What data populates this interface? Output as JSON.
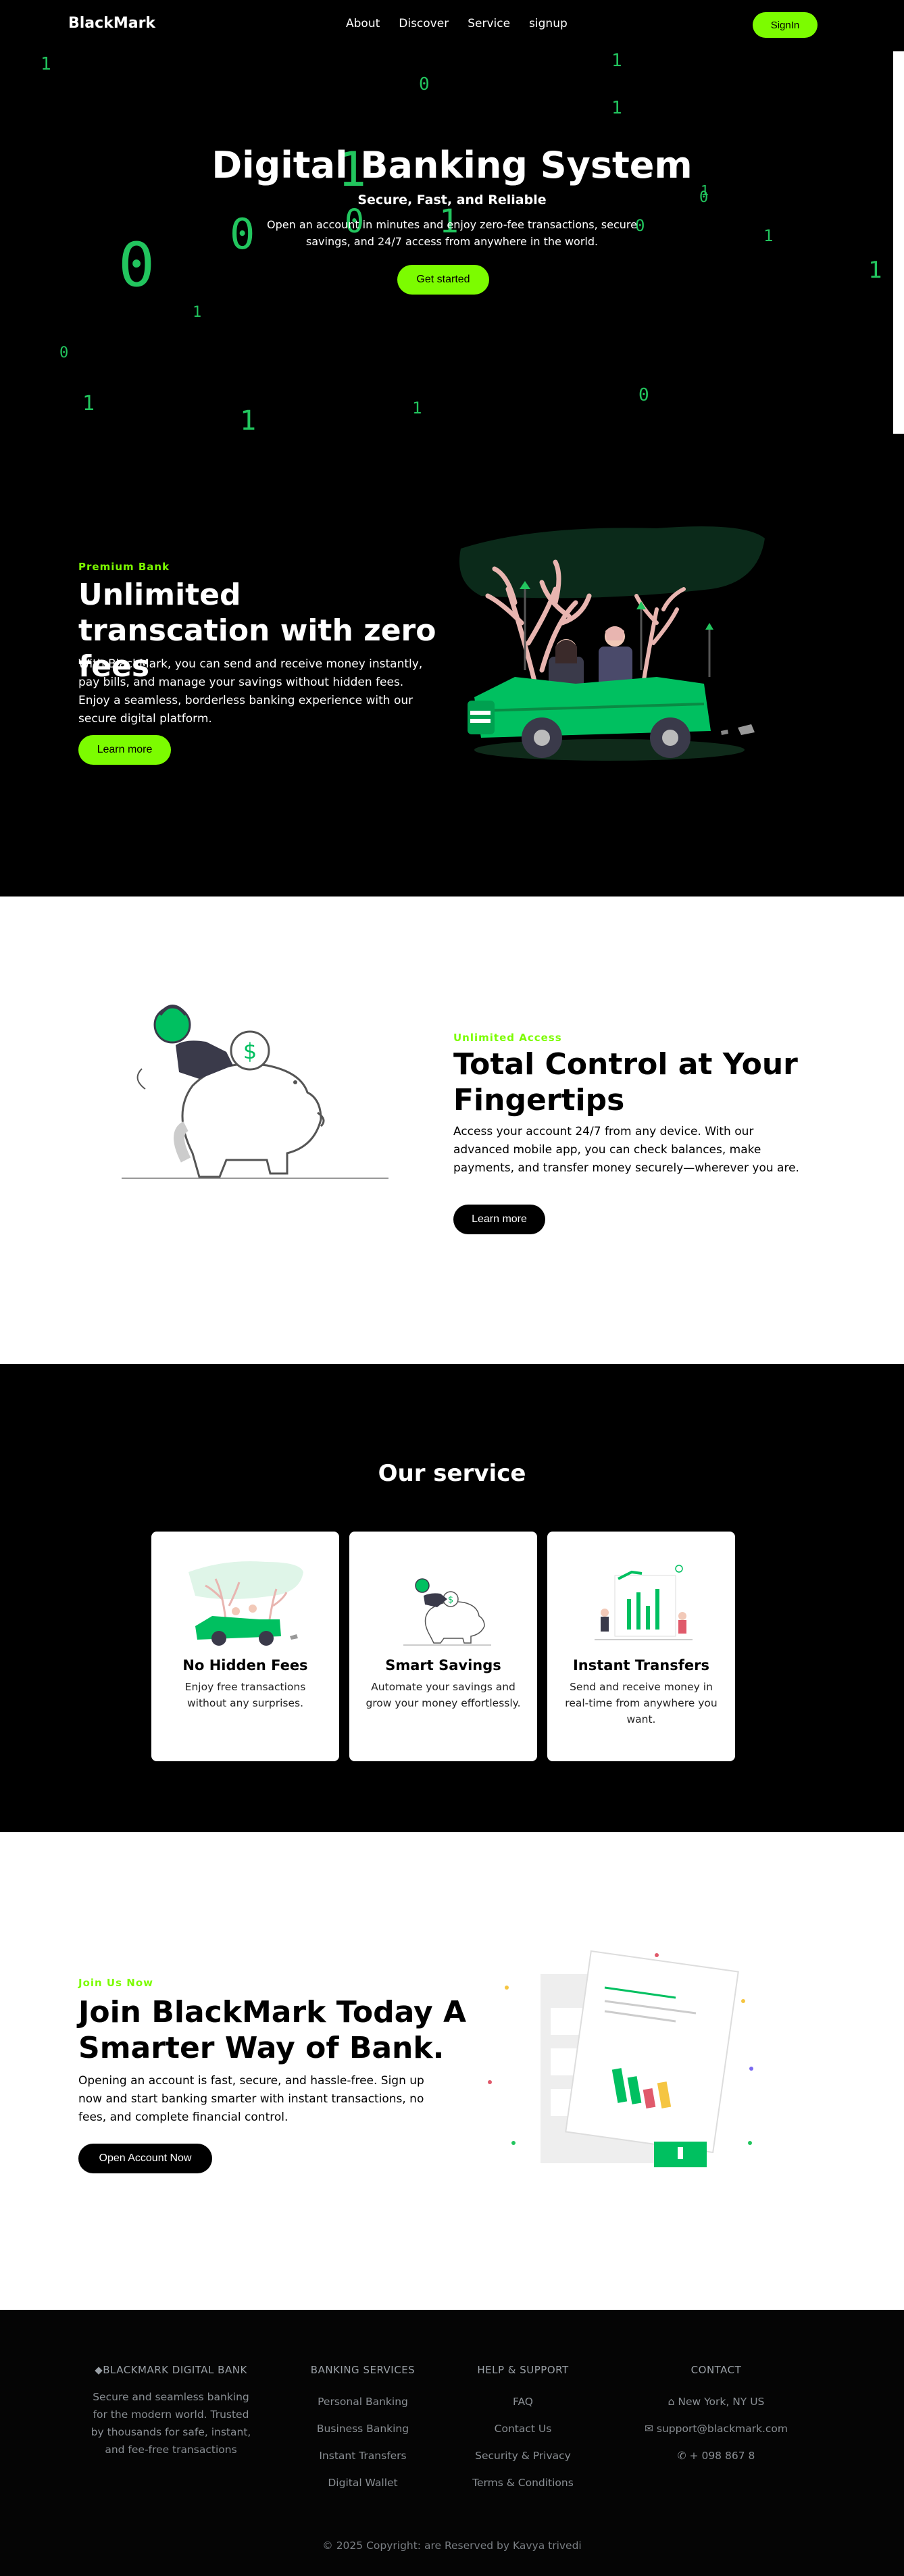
{
  "nav": {
    "brand": "BlackMark",
    "links": [
      "About",
      "Discover",
      "Service",
      "signup"
    ],
    "signin": "SignIn"
  },
  "hero": {
    "title": "Digital Banking System",
    "subtitle": "Secure, Fast, and Reliable",
    "description": "Open an account in minutes and enjoy zero-fee transactions, secure savings, and 24/7 access from anywhere in the world.",
    "cta": "Get started",
    "rain_digits": [
      "1",
      "0",
      "1",
      "1",
      "0",
      "1",
      "1",
      "0",
      "0",
      "1",
      "0",
      "1",
      "1",
      "0",
      "1",
      "0",
      "1",
      "0",
      "1",
      "1",
      "0",
      "1"
    ]
  },
  "feature_unlimited": {
    "eyebrow": "Premium Bank",
    "title": "Unlimited transcation with zero fees",
    "description": "With BlackMark, you can send and receive money instantly, pay bills, and manage your savings without hidden fees. Enjoy a seamless, borderless banking experience with our secure digital platform.",
    "cta": "Learn more"
  },
  "feature_control": {
    "eyebrow": "Unlimited Access",
    "title": "Total Control at Your Fingertips",
    "description": "Access your account 24/7 from any device. With our advanced mobile app, you can check balances, make payments, and transfer money securely—wherever you are.",
    "cta": "Learn more"
  },
  "services": {
    "title": "Our service",
    "cards": [
      {
        "title": "No Hidden Fees",
        "description": "Enjoy free transactions without any surprises."
      },
      {
        "title": "Smart Savings",
        "description": "Automate your savings and grow your money effortlessly."
      },
      {
        "title": "Instant Transfers",
        "description": "Send and receive money in real-time from anywhere you want."
      }
    ]
  },
  "join": {
    "eyebrow": "Join Us Now",
    "title": "Join BlackMark Today A Smarter Way of Bank.",
    "description": "Opening an account is fast, secure, and hassle-free. Sign up now and start banking smarter with instant transactions, no fees, and complete financial control.",
    "cta": "Open Account Now"
  },
  "footer": {
    "brand_heading": "BLACKMARK DIGITAL BANK",
    "brand_description": "Secure and seamless banking for the modern world. Trusted by thousands for safe, instant, and fee-free transactions",
    "banking_heading": "BANKING SERVICES",
    "banking_items": [
      "Personal Banking",
      "Business Banking",
      "Instant Transfers",
      "Digital Wallet"
    ],
    "help_heading": "HELP & SUPPORT",
    "help_items": [
      "FAQ",
      "Contact Us",
      "Security & Privacy",
      "Terms & Conditions"
    ],
    "contact_heading": "CONTACT",
    "contact_address": "New York, NY US",
    "contact_email": "support@blackmark.com",
    "contact_phone": "+ 098 867 8",
    "copyright": "© 2025 Copyright: are Reserved by Kavya trivedi"
  },
  "colors": {
    "accent": "#7cfc00",
    "rain": "#22c55e",
    "illustration_green": "#00c060"
  }
}
